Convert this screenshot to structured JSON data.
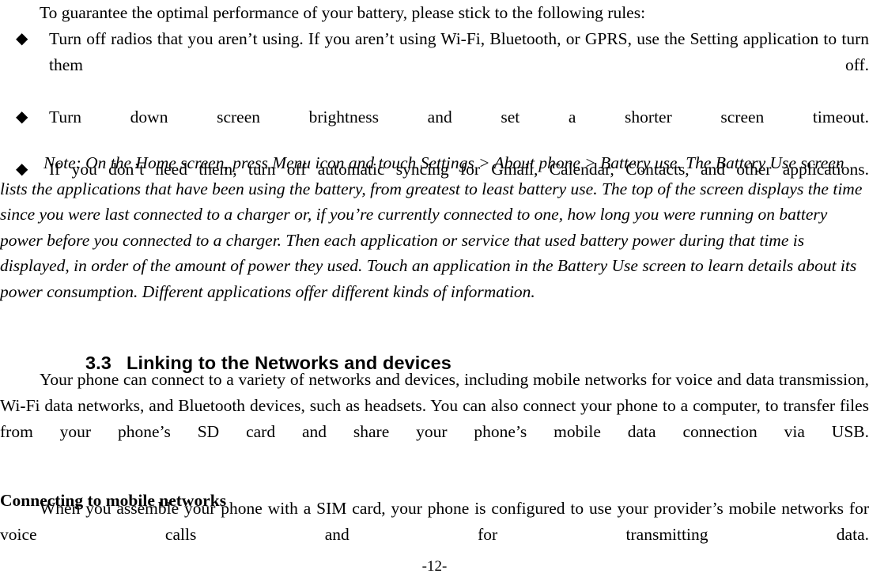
{
  "document": {
    "intro_line": "To guarantee the optimal performance of your battery, please stick to the following rules:",
    "bullet_glyph": "◆",
    "bullets": [
      "Turn off radios that you aren’t using. If you aren’t using Wi-Fi, Bluetooth, or GPRS, use the Setting application to turn them off.",
      "Turn down screen brightness and set a shorter screen timeout.",
      "If you don’t need them, turn off automatic syncing for Gmail, Calendar, Contacts, and other applications."
    ],
    "note_paragraph": "Note: On the Home screen, press Menu icon and touch Settings > About phone > Battery use. The Battery Use screen lists the applications that have been using the battery, from greatest to least battery use. The top of the screen displays the time since you were last connected to a charger or, if you’re currently connected to one, how long you were running on battery power before you connected to a charger. Then each application or service that used battery power during that time is displayed, in order of the amount of power they used. Touch an application in the Battery Use screen to learn details about its power consumption. Different applications offer different kinds of information.",
    "section": {
      "number": "3.3",
      "title": "Linking to the Networks and devices"
    },
    "body_paragraph": "Your phone can connect to a variety of networks and devices, including mobile networks for voice and data transmission, Wi-Fi data networks, and Bluetooth devices, such as headsets. You can also connect your phone to a computer, to transfer files from your phone’s SD card and share your phone’s mobile data connection via USB.",
    "sub_heading": "Connecting to mobile networks",
    "closing_paragraph": "When you assemble your phone with a SIM card, your phone is configured to use your provider’s mobile networks for voice calls and for transmitting data.",
    "page_number": "-12-"
  },
  "colors": {
    "text": "#000000",
    "background": "#ffffff"
  }
}
